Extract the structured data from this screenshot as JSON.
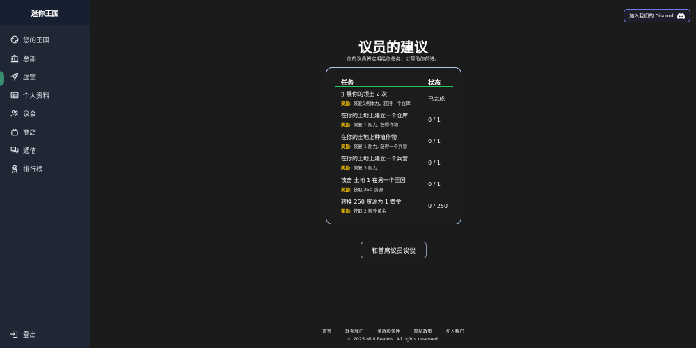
{
  "sidebar": {
    "app_title": "迷你王国",
    "items": [
      {
        "label": "您的王国",
        "icon": "globe-icon"
      },
      {
        "label": "总部",
        "icon": "bank-icon"
      },
      {
        "label": "虚空",
        "icon": "rocket-icon"
      },
      {
        "label": "个人资料",
        "icon": "id-card-icon"
      },
      {
        "label": "议会",
        "icon": "people-icon"
      },
      {
        "label": "商店",
        "icon": "shopping-bag-icon"
      },
      {
        "label": "通信",
        "icon": "chat-icon"
      },
      {
        "label": "排行榜",
        "icon": "award-icon"
      }
    ],
    "logout_label": "登出"
  },
  "header": {
    "discord_label": "加入我们的 Discord"
  },
  "main": {
    "title": "议员的建议",
    "subtitle": "你的议员将定期给你任务，以帮助你前进。",
    "table": {
      "col_task": "任务",
      "col_status": "状态",
      "reward_label": "奖励:",
      "rows": [
        {
          "task": "扩展你的领土 2 次",
          "reward": "恢复6点体力，获得一个仓库",
          "status": "已完成"
        },
        {
          "task": "在你的土地上建立一个仓库",
          "reward": "恢复 1 耐力, 获得作物",
          "status": "0 / 1"
        },
        {
          "task": "在你的土地上种植作物",
          "reward": "恢复 1 耐力, 获得一个兵营",
          "status": "0 / 1"
        },
        {
          "task": "在你的土地上建立一个兵营",
          "reward": "恢复 3 耐力",
          "status": "0 / 1"
        },
        {
          "task": "攻击 土地 1 在另一个王国",
          "reward": "获取 250 资源",
          "status": "0 / 1"
        },
        {
          "task": "转换 250 资源为 1 黄金",
          "reward": "获取 2 额外黄金",
          "status": "0 / 250"
        }
      ]
    },
    "talk_button": "和首席议员谈谈"
  },
  "footer": {
    "links": [
      "首页",
      "联系我们",
      "条款和条件",
      "隐私政策",
      "加入我们"
    ],
    "copyright": "© 2025 Mini Realms. All rights reserved."
  },
  "colors": {
    "accent_green": "#27c74c",
    "reward_yellow": "#f2c000",
    "card_border": "#a9c6e6",
    "discord_border": "#7078e8"
  }
}
